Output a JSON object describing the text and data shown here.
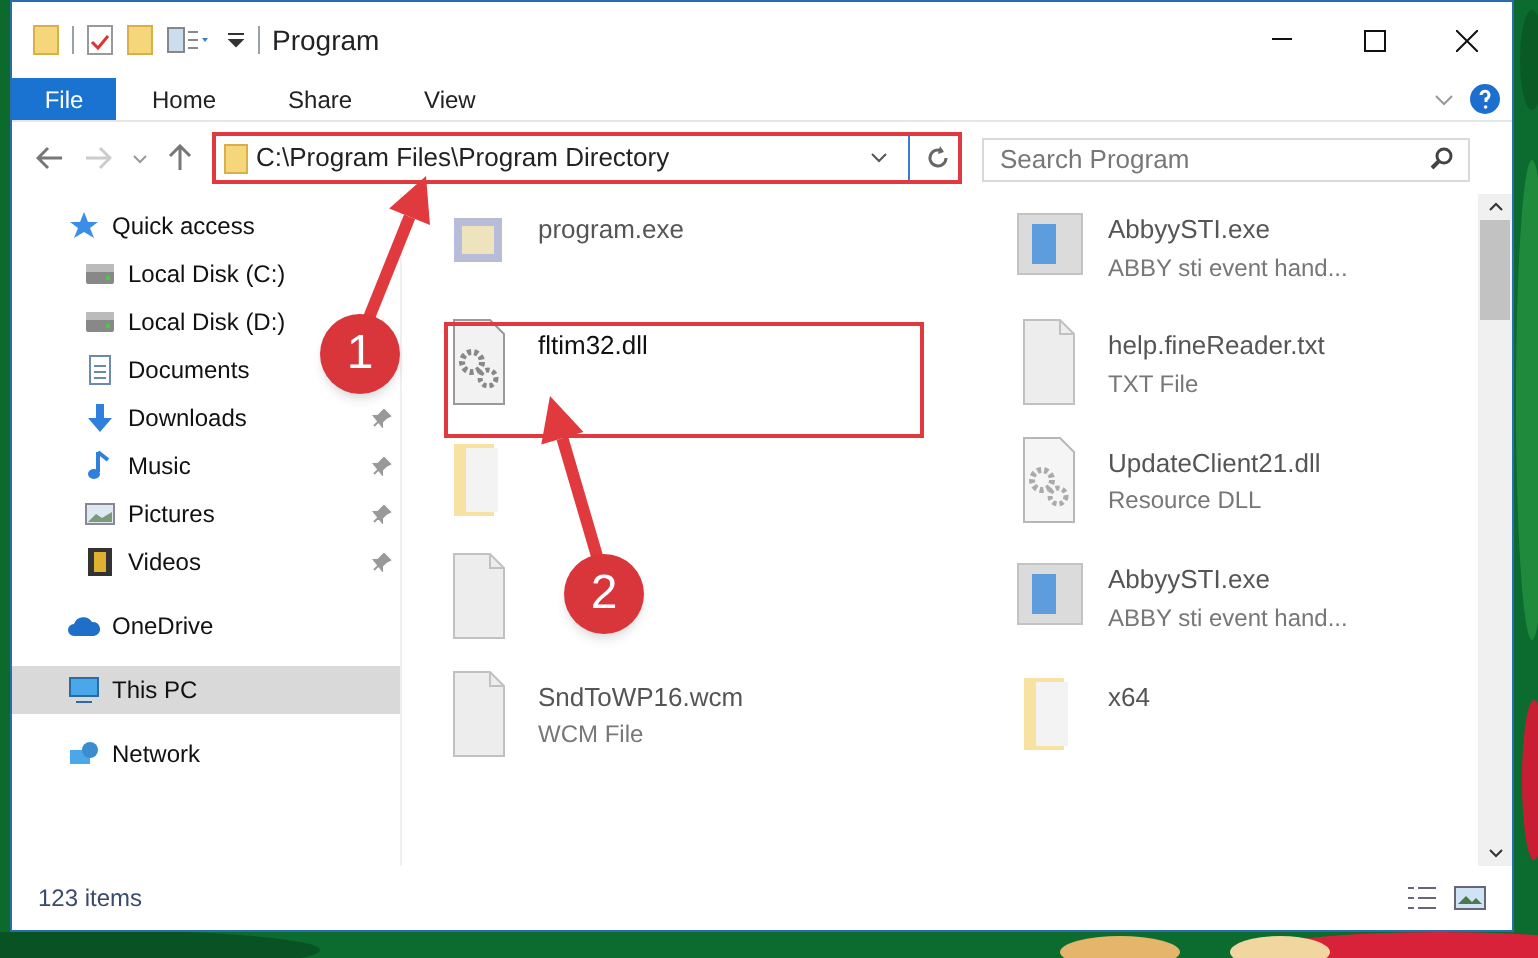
{
  "window": {
    "title": "Program"
  },
  "ribbon_tabs": [
    {
      "label": "File",
      "selected": true
    },
    {
      "label": "Home",
      "selected": false
    },
    {
      "label": "Share",
      "selected": false
    },
    {
      "label": "View",
      "selected": false
    }
  ],
  "address_bar": {
    "path": "C:\\Program Files\\Program Directory"
  },
  "search": {
    "placeholder": "Search Program"
  },
  "sidebar": {
    "items": [
      {
        "label": "Quick access",
        "kind": "star",
        "pinned": false,
        "selected": false,
        "children": [
          {
            "label": "Local Disk (C:)",
            "kind": "disk",
            "pinned": false,
            "selected": false
          },
          {
            "label": "Local Disk (D:)",
            "kind": "disk",
            "pinned": false,
            "selected": false
          },
          {
            "label": "Documents",
            "kind": "document",
            "pinned": false,
            "selected": false
          },
          {
            "label": "Downloads",
            "kind": "download",
            "pinned": true,
            "selected": false
          },
          {
            "label": "Music",
            "kind": "music",
            "pinned": true,
            "selected": false
          },
          {
            "label": "Pictures",
            "kind": "pictures",
            "pinned": true,
            "selected": false
          },
          {
            "label": "Videos",
            "kind": "video",
            "pinned": true,
            "selected": false
          }
        ]
      },
      {
        "label": "OneDrive",
        "kind": "cloud",
        "pinned": false,
        "selected": false
      },
      {
        "label": "This PC",
        "kind": "pc",
        "pinned": false,
        "selected": true
      },
      {
        "label": "Network",
        "kind": "network",
        "pinned": false,
        "selected": false
      }
    ]
  },
  "files": [
    {
      "name": "program.exe",
      "kind": "exe",
      "blurred": true
    },
    {
      "name": "AbbyySTI.exe",
      "detail": "ABBY sti event hand...",
      "kind": "app",
      "blurred": true
    },
    {
      "name": "fltim32.dll",
      "kind": "dll",
      "blurred": false
    },
    {
      "name": "help.fineReader.txt",
      "detail": "TXT File",
      "kind": "txt",
      "blurred": true
    },
    {
      "kind": "folder",
      "blurred": true
    },
    {
      "name": "UpdateClient21.dll",
      "detail": "Resource DLL",
      "kind": "dll",
      "blurred": true
    },
    {
      "kind": "txt",
      "blurred": true
    },
    {
      "name": "AbbyySTI.exe",
      "detail": "ABBY sti event hand...",
      "kind": "app",
      "blurred": true
    },
    {
      "name": "SndToWP16.wcm",
      "detail": "WCM File",
      "kind": "txt",
      "blurred": true
    },
    {
      "name": "x64",
      "kind": "folder",
      "blurred": true
    }
  ],
  "callouts": [
    {
      "number": "1"
    },
    {
      "number": "2"
    }
  ],
  "status_bar": {
    "item_count": "123 items"
  }
}
